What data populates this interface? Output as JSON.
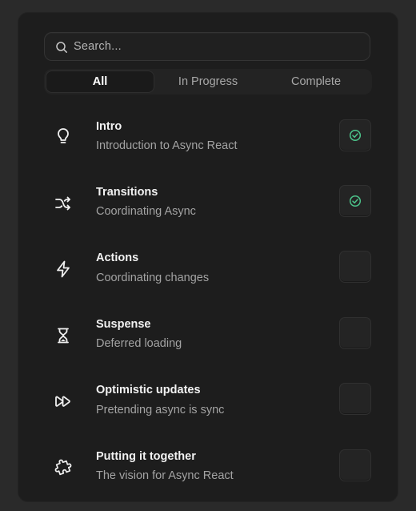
{
  "search": {
    "placeholder": "Search..."
  },
  "tabs": [
    {
      "label": "All",
      "active": true
    },
    {
      "label": "In Progress",
      "active": false
    },
    {
      "label": "Complete",
      "active": false
    }
  ],
  "lessons": [
    {
      "title": "Intro",
      "subtitle": "Introduction to Async React",
      "icon": "lightbulb-icon",
      "complete": true
    },
    {
      "title": "Transitions",
      "subtitle": "Coordinating Async",
      "icon": "shuffle-icon",
      "complete": true
    },
    {
      "title": "Actions",
      "subtitle": "Coordinating changes",
      "icon": "lightning-icon",
      "complete": false
    },
    {
      "title": "Suspense",
      "subtitle": "Deferred loading",
      "icon": "hourglass-icon",
      "complete": false
    },
    {
      "title": "Optimistic updates",
      "subtitle": "Pretending async is sync",
      "icon": "fast-forward-icon",
      "complete": false
    },
    {
      "title": "Putting it together",
      "subtitle": "The vision for Async React",
      "icon": "puzzle-icon",
      "complete": false
    }
  ],
  "colors": {
    "check": "#4cc38a",
    "background": "#1d1d1d"
  }
}
